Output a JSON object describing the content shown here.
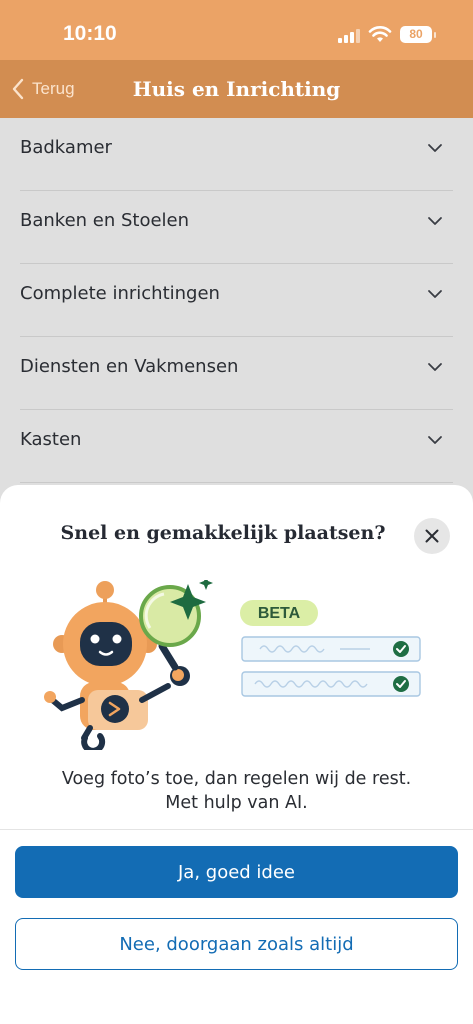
{
  "status_bar": {
    "time": "10:10",
    "battery": "80"
  },
  "nav": {
    "back_label": "Terug",
    "title": "Huis en Inrichting"
  },
  "categories": [
    {
      "label": "Badkamer"
    },
    {
      "label": "Banken en Stoelen"
    },
    {
      "label": "Complete inrichtingen"
    },
    {
      "label": "Diensten en Vakmensen"
    },
    {
      "label": "Kasten"
    }
  ],
  "sheet": {
    "title": "Snel en gemakkelijk plaatsen?",
    "badge": "BETA",
    "description_line1": "Voeg foto’s toe, dan regelen wij de rest.",
    "description_line2": "Met hulp van AI.",
    "primary_button": "Ja, goed idee",
    "secondary_button": "Nee, doorgaan zoals altijd"
  },
  "colors": {
    "status_bar": "#eba366",
    "nav_bar": "#d28d51",
    "primary": "#136cb4",
    "badge": "#dbeea6",
    "check": "#1f6e44"
  }
}
